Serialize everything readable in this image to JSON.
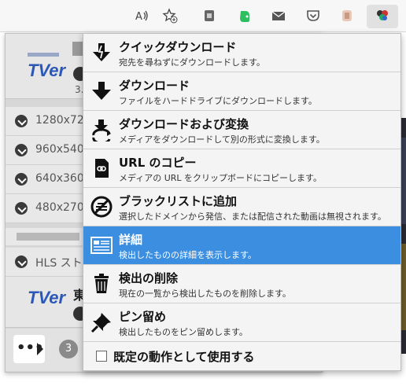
{
  "colors": {
    "accent": "#3b8ee0",
    "tver_blue": "#2a57b8"
  },
  "toolbar": {
    "icons": [
      "read-aloud-icon",
      "add-favorite-icon",
      "extension-icon",
      "evernote-icon",
      "mail-icon",
      "pocket-icon",
      "extension-icon-2",
      "video-downloader-icon"
    ]
  },
  "popup": {
    "card_logo": "TVer",
    "card_top_num": "3.",
    "card_bottom_title": "東",
    "resolutions": [
      "1280x72",
      "960x540",
      "640x360",
      "480x270"
    ],
    "hls_label": "HLS スト",
    "badge_count": "3",
    "more_label": "•••"
  },
  "menu": {
    "items": [
      {
        "title": "クイックダウンロード",
        "desc": "宛先を尋ねずにダウンロードします。",
        "icon": "quick-download-icon"
      },
      {
        "title": "ダウンロード",
        "desc": "ファイルをハードドライブにダウンロードします。",
        "icon": "download-icon"
      },
      {
        "title": "ダウンロードおよび変換",
        "desc": "メディアをダウンロードして別の形式に変換します。",
        "icon": "download-convert-icon"
      },
      {
        "title": "URL のコピー",
        "desc": "メディアの URL をクリップボードにコピーします。",
        "icon": "copy-url-icon"
      },
      {
        "title": "ブラックリストに追加",
        "desc": "選択したドメインから発信、または配信された動画は無視されます。",
        "icon": "blacklist-icon"
      },
      {
        "title": "詳細",
        "desc": "検出したものの詳細を表示します。",
        "icon": "details-icon"
      },
      {
        "title": "検出の削除",
        "desc": "現在の一覧から検出したものを削除します。",
        "icon": "trash-icon"
      },
      {
        "title": "ピン留め",
        "desc": "検出したものをピン留めします。",
        "icon": "pin-icon"
      }
    ],
    "default_label": "既定の動作として使用する"
  }
}
